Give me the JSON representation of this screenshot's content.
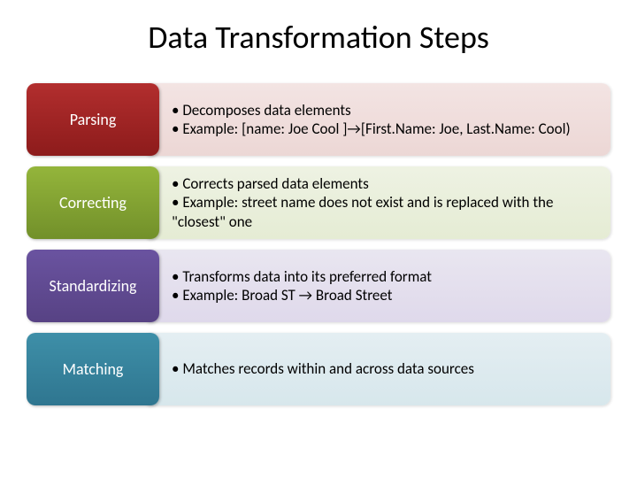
{
  "title": "Data Transformation Steps",
  "rows": [
    {
      "label": "Parsing",
      "bullets": [
        "Decomposes data elements",
        "Example: [name: Joe Cool ]→[First.Name: Joe, Last.Name: Cool)"
      ]
    },
    {
      "label": "Correcting",
      "bullets": [
        "Corrects parsed data elements",
        "Example: street name does not exist and is replaced with the \"closest\" one"
      ]
    },
    {
      "label": "Standardizing",
      "bullets": [
        "Transforms data into its preferred format",
        "Example: Broad ST → Broad Street"
      ]
    },
    {
      "label": "Matching",
      "bullets": [
        "Matches records within and across data sources"
      ]
    }
  ]
}
